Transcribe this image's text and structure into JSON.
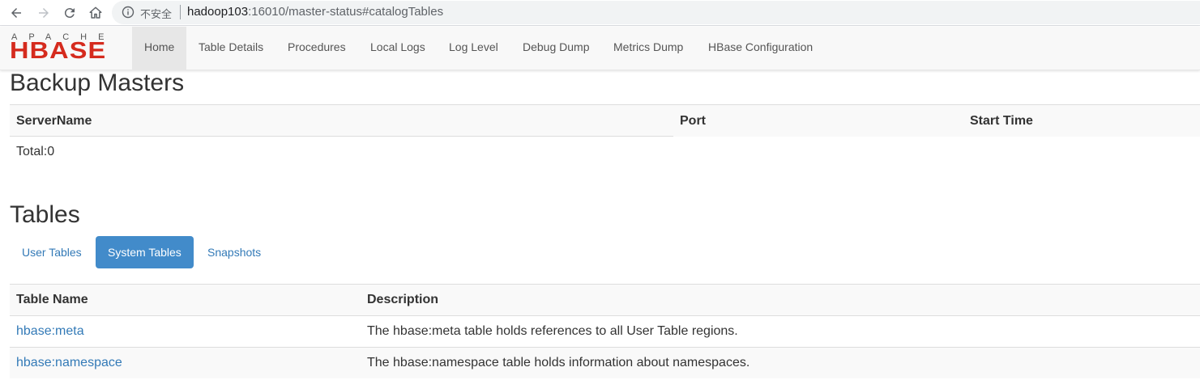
{
  "browser": {
    "security_label": "不安全",
    "url_host": "hadoop103",
    "url_rest": ":16010/master-status#catalogTables"
  },
  "navbar": {
    "logo_top": "APACHE",
    "logo_main": "HBASE",
    "items": [
      {
        "label": "Home"
      },
      {
        "label": "Table Details"
      },
      {
        "label": "Procedures"
      },
      {
        "label": "Local Logs"
      },
      {
        "label": "Log Level"
      },
      {
        "label": "Debug Dump"
      },
      {
        "label": "Metrics Dump"
      },
      {
        "label": "HBase Configuration"
      }
    ]
  },
  "backup_masters": {
    "title": "Backup Masters",
    "columns": [
      "ServerName",
      "Port",
      "Start Time"
    ],
    "total": "Total:0"
  },
  "tables": {
    "title": "Tables",
    "tabs": [
      {
        "label": "User Tables"
      },
      {
        "label": "System Tables"
      },
      {
        "label": "Snapshots"
      }
    ],
    "columns": [
      "Table Name",
      "Description"
    ],
    "rows": [
      {
        "name": "hbase:meta",
        "description": "The hbase:meta table holds references to all User Table regions."
      },
      {
        "name": "hbase:namespace",
        "description": "The hbase:namespace table holds information about namespaces."
      }
    ]
  },
  "colors": {
    "accent": "#428bca",
    "link": "#337ab7",
    "logo_red": "#d52b1e"
  }
}
